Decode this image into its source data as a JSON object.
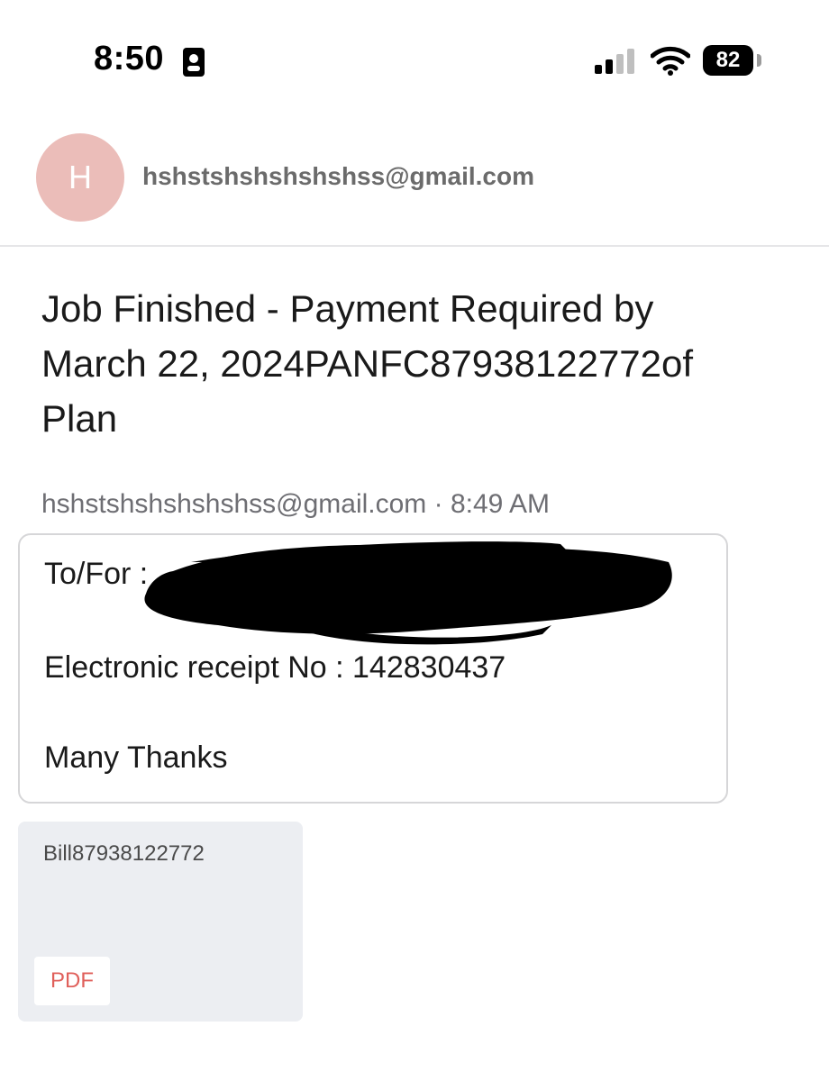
{
  "status_bar": {
    "time": "8:50",
    "battery_level": "82",
    "signal_bars_active": 2,
    "signal_bars_total": 4,
    "icons": [
      "contact-card-icon",
      "cellular-signal-icon",
      "wifi-icon",
      "battery-icon"
    ]
  },
  "sender": {
    "avatar_initial": "H",
    "avatar_color": "#ebbdb9",
    "email": "hshstshshshshshss@gmail.com"
  },
  "email": {
    "subject_lines": [
      "Job Finished - Payment Required by",
      "March 22, 2024PANFC87938122772of",
      "Plan"
    ],
    "from": "hshstshshshshshss@gmail.com",
    "separator": "·",
    "time": "8:49 AM",
    "body": {
      "to_for_label": "To/For :",
      "receipt_line": "Electronic receipt No : 142830437",
      "closing": "Many Thanks"
    }
  },
  "attachment": {
    "name": "Bill87938122772",
    "type_label": "PDF",
    "type_color": "#e0605b"
  }
}
